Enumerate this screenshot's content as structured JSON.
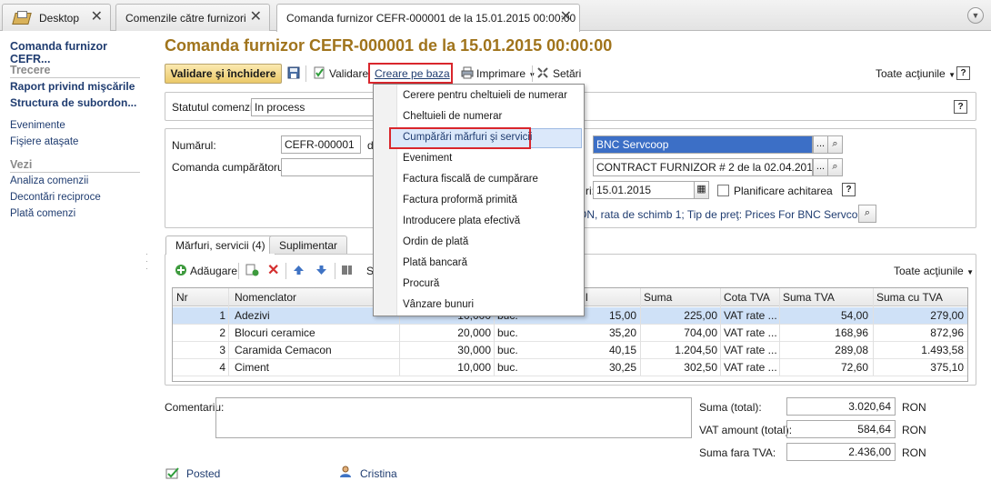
{
  "tabs": [
    {
      "label": "Desktop"
    },
    {
      "label": "Comenzile către furnizori"
    },
    {
      "label": "Comanda furnizor CEFR-000001 de la 15.01.2015 00:00:00"
    }
  ],
  "sidebar": {
    "title": "Comanda furnizor CEFR...",
    "section_trecere": "Trecere",
    "trecere_items": [
      "Raport privind mişcările",
      "Structura de subordon..."
    ],
    "links": [
      "Evenimente",
      "Fişiere ataşate"
    ],
    "section_vezi": "Vezi",
    "vezi_items": [
      "Analiza comenzii",
      "Decontări reciproce",
      "Plată comenzi"
    ]
  },
  "header": {
    "title": "Comanda furnizor CEFR-000001 de la 15.01.2015 00:00:00"
  },
  "toolbar": {
    "post_close": "Validare şi închidere",
    "post": "Validare",
    "create_based": "Creare pe baza",
    "print": "Imprimare",
    "settings": "Setări",
    "all_actions": "Toate acţiunile"
  },
  "status": {
    "label": "Statutul comenzii:",
    "value": "In process"
  },
  "form": {
    "number_label": "Numărul:",
    "number_value": "CEFR-000001",
    "date_prefix": "d",
    "buyer_order_label": "Comanda cumpărătorului:",
    "supplier_value": "BNC Servcoop",
    "contract_value": "CONTRACT FURNIZOR # 2 de la 02.04.2015 (R(",
    "pay_date_label": "ri:",
    "pay_date_value": "15.01.2015",
    "planning_label": "Planificare achitarea",
    "prices_text": "ON, rata de schimb 1; Tip de preţ: Prices For BNC Servcoo..."
  },
  "inner_tabs": [
    "Mărfuri, servicii (4)",
    "Suplimentar"
  ],
  "table_toolbar": {
    "add": "Adăugare",
    "s_label": "S",
    "all_actions": "Toate acţiunile"
  },
  "table": {
    "headers": [
      "Nr",
      "Nomenclator",
      "l",
      "Suma",
      "Cota TVA",
      "Suma TVA",
      "Suma cu TVA"
    ],
    "rows": [
      {
        "nr": "1",
        "name": "Adezivi",
        "qty": "10,000",
        "unit": "buc.",
        "price": "15,00",
        "sum": "225,00",
        "vat": "VAT rate ...",
        "vat_sum": "54,00",
        "total": "279,00"
      },
      {
        "nr": "2",
        "name": "Blocuri ceramice",
        "qty": "20,000",
        "unit": "buc.",
        "price": "35,20",
        "sum": "704,00",
        "vat": "VAT rate ...",
        "vat_sum": "168,96",
        "total": "872,96"
      },
      {
        "nr": "3",
        "name": "Caramida Cemacon",
        "qty": "30,000",
        "unit": "buc.",
        "price": "40,15",
        "sum": "1.204,50",
        "vat": "VAT rate ...",
        "vat_sum": "289,08",
        "total": "1.493,58"
      },
      {
        "nr": "4",
        "name": "Ciment",
        "qty": "10,000",
        "unit": "buc.",
        "price": "30,25",
        "sum": "302,50",
        "vat": "VAT rate ...",
        "vat_sum": "72,60",
        "total": "375,10"
      }
    ]
  },
  "menu": {
    "items": [
      "Cerere pentru cheltuieli de numerar",
      "Cheltuieli de numerar",
      "Cumpărări mărfuri şi servicii",
      "Eveniment",
      "Factura fiscală de cumpărare",
      "Factura proformă primită",
      "Introducere plata efectivă",
      "Ordin de plată",
      "Plată bancară",
      "Procură",
      "Vânzare bunuri"
    ]
  },
  "footer": {
    "comment_label": "Comentariu:",
    "sum_total_label": "Suma (total):",
    "sum_total_value": "3.020,64",
    "vat_total_label": "VAT amount (total):",
    "vat_total_value": "584,64",
    "sum_no_vat_label": "Suma fara TVA:",
    "sum_no_vat_value": "2.436,00",
    "currency": "RON",
    "posted": "Posted",
    "author": "Cristina"
  },
  "colors": {
    "accent": "#a0741c",
    "link": "#1f3c70",
    "highlight_red": "#d9262c",
    "selection": "#cfe1f7"
  }
}
